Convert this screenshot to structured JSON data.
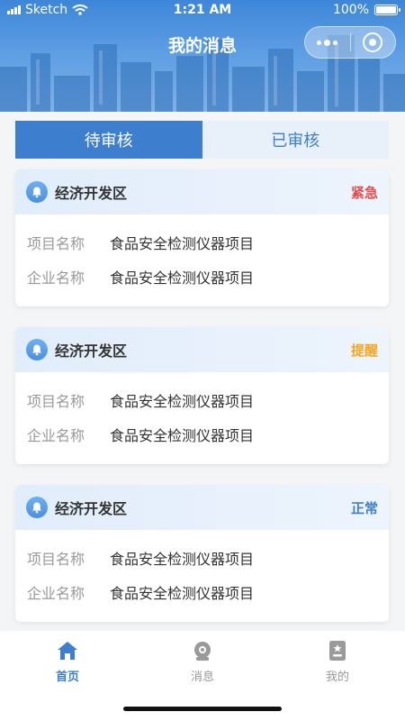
{
  "status_bar": {
    "carrier": "Sketch",
    "time": "1:21 AM",
    "battery": "100%"
  },
  "nav": {
    "title": "我的消息"
  },
  "tabs": [
    {
      "label": "待审核",
      "active": true
    },
    {
      "label": "已审核",
      "active": false
    }
  ],
  "cards": [
    {
      "title": "经济开发区",
      "status": "紧急",
      "status_color": "#e84a4a",
      "rows": [
        {
          "label": "项目名称",
          "value": "食品安全检测仪器项目"
        },
        {
          "label": "企业名称",
          "value": "食品安全检测仪器项目"
        }
      ]
    },
    {
      "title": "经济开发区",
      "status": "提醒",
      "status_color": "#f5a623",
      "rows": [
        {
          "label": "项目名称",
          "value": "食品安全检测仪器项目"
        },
        {
          "label": "企业名称",
          "value": "食品安全检测仪器项目"
        }
      ]
    },
    {
      "title": "经济开发区",
      "status": "正常",
      "status_color": "#3d7fce",
      "rows": [
        {
          "label": "项目名称",
          "value": "食品安全检测仪器项目"
        },
        {
          "label": "企业名称",
          "value": "食品安全检测仪器项目"
        }
      ]
    }
  ],
  "tabbar": [
    {
      "label": "首页",
      "icon": "home-icon",
      "active": true
    },
    {
      "label": "消息",
      "icon": "message-icon",
      "active": false
    },
    {
      "label": "我的",
      "icon": "profile-icon",
      "active": false
    }
  ],
  "colors": {
    "accent": "#3d7fce",
    "inactive": "#999999"
  }
}
